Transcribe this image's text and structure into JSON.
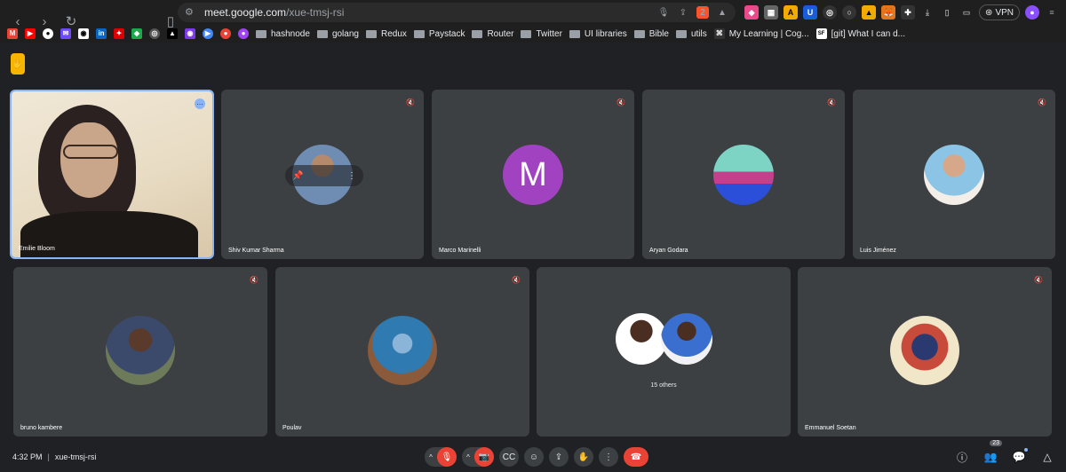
{
  "browser": {
    "url_domain": "meet.google.com",
    "url_path": "/xue-tmsj-rsi",
    "brave_badge": "2",
    "vpn_label": "VPN"
  },
  "bookmarks": [
    {
      "label": "hashnode",
      "type": "folder"
    },
    {
      "label": "golang",
      "type": "folder"
    },
    {
      "label": "Redux",
      "type": "folder"
    },
    {
      "label": "Paystack",
      "type": "folder"
    },
    {
      "label": "Router",
      "type": "folder"
    },
    {
      "label": "Twitter",
      "type": "folder"
    },
    {
      "label": "UI libraries",
      "type": "folder"
    },
    {
      "label": "Bible",
      "type": "folder"
    },
    {
      "label": "utils",
      "type": "folder"
    },
    {
      "label": "My Learning | Cog...",
      "type": "link"
    },
    {
      "label": "[git] What I can d...",
      "type": "link",
      "badge": "SF"
    }
  ],
  "participants": [
    {
      "name": "Emilie Bloom"
    },
    {
      "name": "Shiv Kumar Sharma"
    },
    {
      "name": "Marco Marinelli",
      "initial": "M"
    },
    {
      "name": "Aryan Godara"
    },
    {
      "name": "Luis Jiménez"
    },
    {
      "name": "bruno kambere"
    },
    {
      "name": "Poulav"
    },
    {
      "name": "",
      "others_label": "15 others"
    },
    {
      "name": "Emmanuel Soetan"
    }
  ],
  "meeting": {
    "time": "4:32 PM",
    "separator": "|",
    "code": "xue-tmsj-rsi",
    "participant_count": "23"
  },
  "colors": {
    "background": "#202124",
    "tile": "#3c4043",
    "accent": "#8ab4f8",
    "danger": "#ea4335",
    "hand": "#f7b500"
  }
}
